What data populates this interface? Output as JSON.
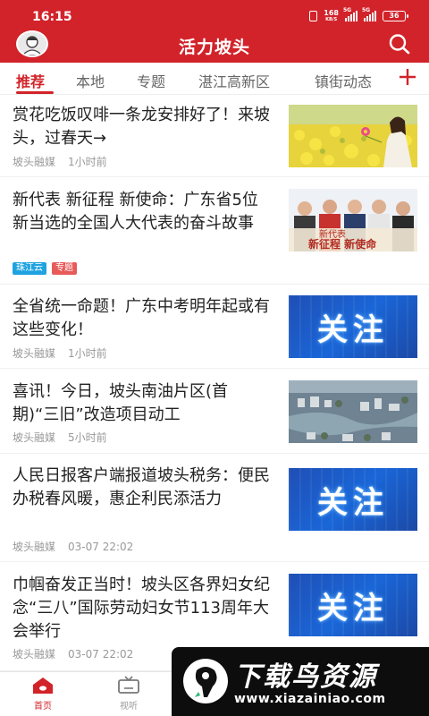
{
  "status_bar": {
    "time": "16:15",
    "net_speed": "168",
    "net_unit": "KB/S",
    "signal_tag_1": "5G",
    "signal_tag_2": "5G",
    "battery": "36"
  },
  "header": {
    "title": "活力坡头",
    "avatar_icon": "user-avatar-icon",
    "search_icon": "search-icon",
    "bg_color": "#d2232a"
  },
  "tabs": {
    "items": [
      {
        "label": "推荐",
        "active": true
      },
      {
        "label": "本地"
      },
      {
        "label": "专题"
      },
      {
        "label": "湛江高新区"
      },
      {
        "label": "镇街动态"
      }
    ],
    "add_icon": "plus-icon"
  },
  "news": [
    {
      "title": "赏花吃饭叹啡一条龙安排好了！来坡头，过春天→",
      "source": "坡头融媒",
      "time": "1小时前",
      "image": "rapeseed-flower-field-photo"
    },
    {
      "title": "新代表 新征程 新使命：广东省5位新当选的全国人大代表的奋斗故事",
      "badges": [
        "珠江云",
        "专题"
      ],
      "image": "representatives-poster",
      "image_text": "新代表 新征程 新使命"
    },
    {
      "title": "全省统一命题！广东中考明年起或有这些变化！",
      "source": "坡头融媒",
      "time": "1小时前",
      "image_text": "关注"
    },
    {
      "title": "喜讯！今日，坡头南油片区(首期)“三旧”改造项目动工",
      "source": "坡头融媒",
      "time": "5小时前",
      "image": "aerial-city-render"
    },
    {
      "title": "人民日报客户端报道坡头税务：便民办税春风暖，惠企利民添活力",
      "source": "坡头融媒",
      "time": "03-07 22:02",
      "image_text": "关注"
    },
    {
      "title": "巾帼奋发正当时！坡头区各界妇女纪念“三八”国际劳动妇女节113周年大会举行",
      "source": "坡头融媒",
      "time": "03-07 22:02",
      "image_text": "关注"
    }
  ],
  "bottom_nav": [
    {
      "label": "首页",
      "icon": "home-icon",
      "active": true
    },
    {
      "label": "视听",
      "icon": "tv-icon"
    }
  ],
  "watermark": {
    "name": "下载鸟资源",
    "url": "www.xiazainiao.com"
  }
}
